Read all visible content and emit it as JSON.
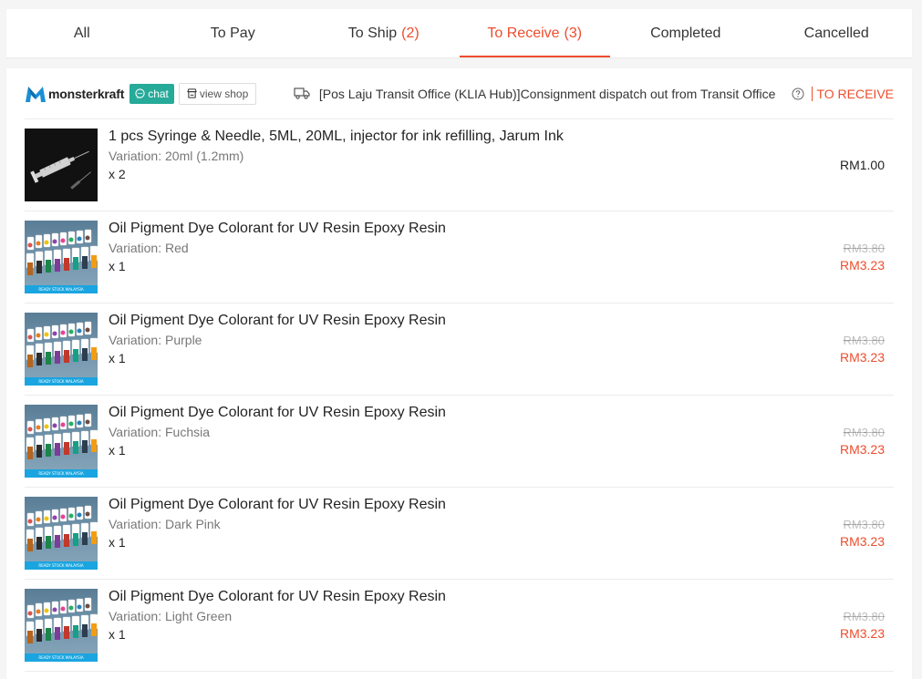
{
  "tabs": [
    {
      "label": "All",
      "count": ""
    },
    {
      "label": "To Pay",
      "count": ""
    },
    {
      "label": "To Ship",
      "count": "(2)"
    },
    {
      "label": "To Receive",
      "count": "(3)"
    },
    {
      "label": "Completed",
      "count": ""
    },
    {
      "label": "Cancelled",
      "count": ""
    }
  ],
  "active_tab": "To Receive",
  "shop": {
    "name": "monsterkraft",
    "chat_label": "chat",
    "view_shop_label": "view shop"
  },
  "status": {
    "message": "[Pos Laju Transit Office (KLIA Hub)]Consignment dispatch out from Transit Office",
    "label": "TO RECEIVE"
  },
  "items": [
    {
      "name": "1 pcs Syringe & Needle, 5ML, 20ML, injector for ink refilling, Jarum Ink",
      "variation": "Variation: 20ml (1.2mm)",
      "qty": "x 2",
      "price": "RM1.00",
      "original_price": "",
      "thumb": "syringe"
    },
    {
      "name": "Oil Pigment Dye Colorant for UV Resin Epoxy Resin",
      "variation": "Variation: Red",
      "qty": "x 1",
      "price": "RM3.23",
      "original_price": "RM3.80",
      "thumb": "pigment"
    },
    {
      "name": "Oil Pigment Dye Colorant for UV Resin Epoxy Resin",
      "variation": "Variation: Purple",
      "qty": "x 1",
      "price": "RM3.23",
      "original_price": "RM3.80",
      "thumb": "pigment"
    },
    {
      "name": "Oil Pigment Dye Colorant for UV Resin Epoxy Resin",
      "variation": "Variation: Fuchsia",
      "qty": "x 1",
      "price": "RM3.23",
      "original_price": "RM3.80",
      "thumb": "pigment"
    },
    {
      "name": "Oil Pigment Dye Colorant for UV Resin Epoxy Resin",
      "variation": "Variation: Dark Pink",
      "qty": "x 1",
      "price": "RM3.23",
      "original_price": "RM3.80",
      "thumb": "pigment"
    },
    {
      "name": "Oil Pigment Dye Colorant for UV Resin Epoxy Resin",
      "variation": "Variation: Light Green",
      "qty": "x 1",
      "price": "RM3.23",
      "original_price": "RM3.80",
      "thumb": "pigment"
    }
  ],
  "thumb_banner_text": "READY STOCK MALAYSIA",
  "colors": {
    "accent": "#ee4d2d",
    "chat": "#26aa99",
    "banner": "#1aa5e0"
  }
}
